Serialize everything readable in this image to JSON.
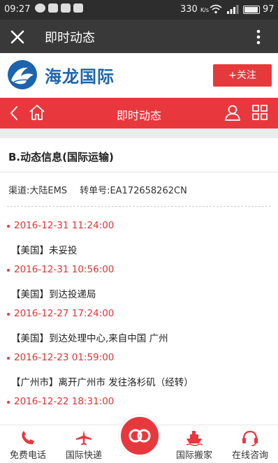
{
  "status_bar": {
    "time": "09:27",
    "speed": "330",
    "speed_unit": "K/s",
    "battery": "97"
  },
  "title_bar": {
    "title": "即时动态"
  },
  "brand": {
    "name": "海龙国际",
    "follow_label": "+关注"
  },
  "nav_bar": {
    "title": "即时动态"
  },
  "tracking": {
    "heading": "B.动态信息(国际运输)",
    "channel_label": "渠道:大陆EMS",
    "transfer_label": "转单号:EA172658262CN",
    "events": [
      {
        "time": "2016-12-31 11:24:00",
        "desc": "【美国】未妥投"
      },
      {
        "time": "2016-12-31 10:56:00",
        "desc": "【美国】到达投递局"
      },
      {
        "time": "2016-12-27 17:24:00",
        "desc": "【美国】到达处理中心,来自中国 广州"
      },
      {
        "time": "2016-12-23 01:59:00",
        "desc": "【广州市】离开广州市 发往洛杉矶（经转）"
      },
      {
        "time": "2016-12-22 18:31:00",
        "desc": ""
      }
    ]
  },
  "tab_bar": {
    "items": [
      {
        "label": "免费电话",
        "icon": "phone-icon"
      },
      {
        "label": "国际快递",
        "icon": "plane-icon"
      },
      {
        "label": "国际搬家",
        "icon": "ship-icon"
      },
      {
        "label": "在线咨询",
        "icon": "headset-icon"
      }
    ]
  },
  "colors": {
    "accent": "#e8383d",
    "brand_blue": "#1c64ad",
    "time_red": "#e13333"
  }
}
